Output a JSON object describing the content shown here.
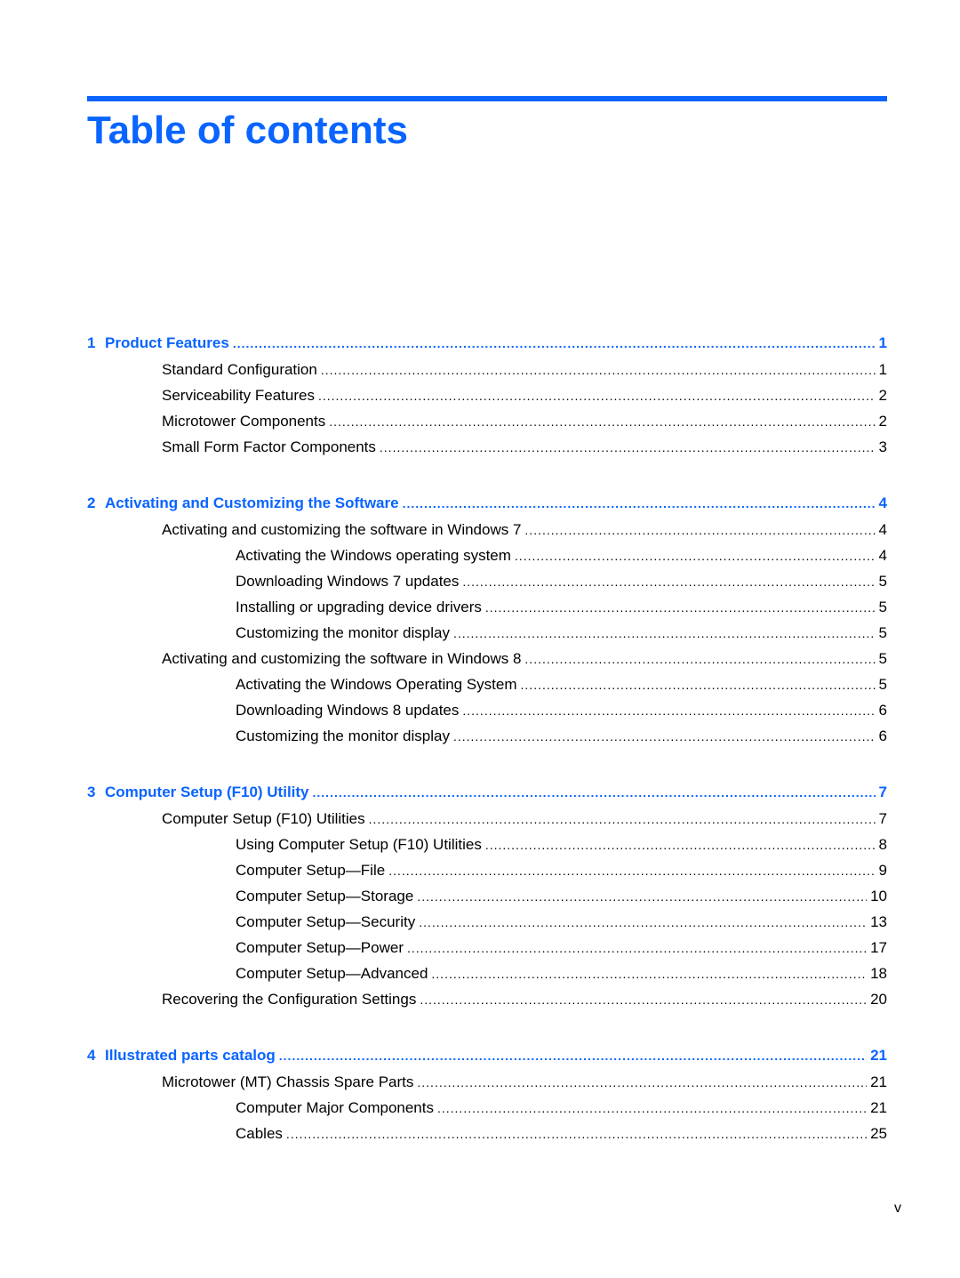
{
  "page": {
    "title": "Table of contents",
    "folio": "v",
    "accent_color": "#0a64ff"
  },
  "chapters": [
    {
      "number": "1",
      "title": "Product Features",
      "page": "1",
      "entries": [
        {
          "level": 1,
          "title": "Standard Configuration",
          "page": "1"
        },
        {
          "level": 1,
          "title": "Serviceability Features",
          "page": "2"
        },
        {
          "level": 1,
          "title": "Microtower Components",
          "page": "2"
        },
        {
          "level": 1,
          "title": "Small Form Factor Components",
          "page": "3"
        }
      ]
    },
    {
      "number": "2",
      "title": "Activating and Customizing the Software",
      "page": "4",
      "entries": [
        {
          "level": 1,
          "title": "Activating and customizing the software in Windows 7",
          "page": "4"
        },
        {
          "level": 2,
          "title": "Activating the Windows operating system",
          "page": "4"
        },
        {
          "level": 2,
          "title": "Downloading Windows 7 updates",
          "page": "5"
        },
        {
          "level": 2,
          "title": "Installing or upgrading device drivers",
          "page": "5"
        },
        {
          "level": 2,
          "title": "Customizing the monitor display",
          "page": "5"
        },
        {
          "level": 1,
          "title": "Activating and customizing the software in Windows 8",
          "page": "5"
        },
        {
          "level": 2,
          "title": "Activating the Windows Operating System",
          "page": "5"
        },
        {
          "level": 2,
          "title": "Downloading Windows 8 updates",
          "page": "6"
        },
        {
          "level": 2,
          "title": "Customizing the monitor display",
          "page": "6"
        }
      ]
    },
    {
      "number": "3",
      "title": "Computer Setup (F10) Utility",
      "page": "7",
      "entries": [
        {
          "level": 1,
          "title": "Computer Setup (F10) Utilities",
          "page": "7"
        },
        {
          "level": 2,
          "title": "Using Computer Setup (F10) Utilities",
          "page": "8"
        },
        {
          "level": 2,
          "title": "Computer Setup—File",
          "page": "9"
        },
        {
          "level": 2,
          "title": "Computer Setup—Storage",
          "page": "10"
        },
        {
          "level": 2,
          "title": "Computer Setup—Security",
          "page": "13"
        },
        {
          "level": 2,
          "title": "Computer Setup—Power",
          "page": "17"
        },
        {
          "level": 2,
          "title": "Computer Setup—Advanced",
          "page": "18"
        },
        {
          "level": 1,
          "title": "Recovering the Configuration Settings",
          "page": "20"
        }
      ]
    },
    {
      "number": "4",
      "title": "Illustrated parts catalog",
      "page": "21",
      "entries": [
        {
          "level": 1,
          "title": "Microtower (MT) Chassis Spare Parts",
          "page": "21"
        },
        {
          "level": 2,
          "title": "Computer Major Components",
          "page": "21"
        },
        {
          "level": 2,
          "title": "Cables",
          "page": "25"
        }
      ]
    }
  ]
}
